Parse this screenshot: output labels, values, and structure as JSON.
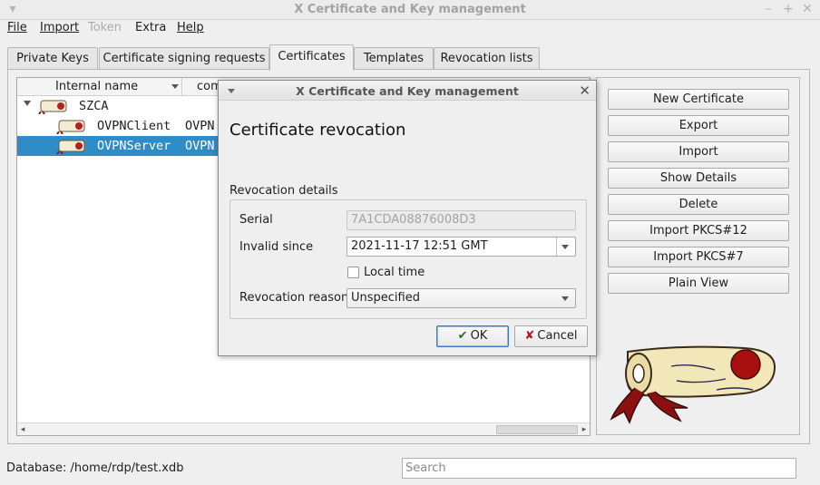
{
  "window": {
    "title": "X Certificate and Key management"
  },
  "menu": {
    "file": "File",
    "import": "Import",
    "token": "Token",
    "extra": "Extra",
    "help": "Help"
  },
  "tabs": [
    "Private Keys",
    "Certificate signing requests",
    "Certificates",
    "Templates",
    "Revocation lists"
  ],
  "active_tab": "Certificates",
  "tree": {
    "columns": [
      "Internal name",
      "com"
    ],
    "rows": [
      {
        "name": "SZCA",
        "col2": ""
      },
      {
        "name": "OVPNClient",
        "col2": "OVPN"
      },
      {
        "name": "OVPNServer",
        "col2": "OVPN"
      }
    ]
  },
  "actions": [
    "New Certificate",
    "Export",
    "Import",
    "Show Details",
    "Delete",
    "Import PKCS#12",
    "Import PKCS#7",
    "Plain View"
  ],
  "status": {
    "database": "Database: /home/rdp/test.xdb",
    "search_placeholder": "Search"
  },
  "dialog": {
    "title": "X Certificate and Key management",
    "heading": "Certificate revocation",
    "group_label": "Revocation details",
    "serial_label": "Serial",
    "serial_value": "7A1CDA08876008D3",
    "invalid_since_label": "Invalid since",
    "invalid_since_value": "2021-11-17 12:51 GMT",
    "local_time_label": "Local time",
    "reason_label": "Revocation reason",
    "reason_value": "Unspecified",
    "ok": "OK",
    "cancel": "Cancel"
  },
  "colors": {
    "selection": "#308cc6",
    "accent": "#3878c6"
  }
}
